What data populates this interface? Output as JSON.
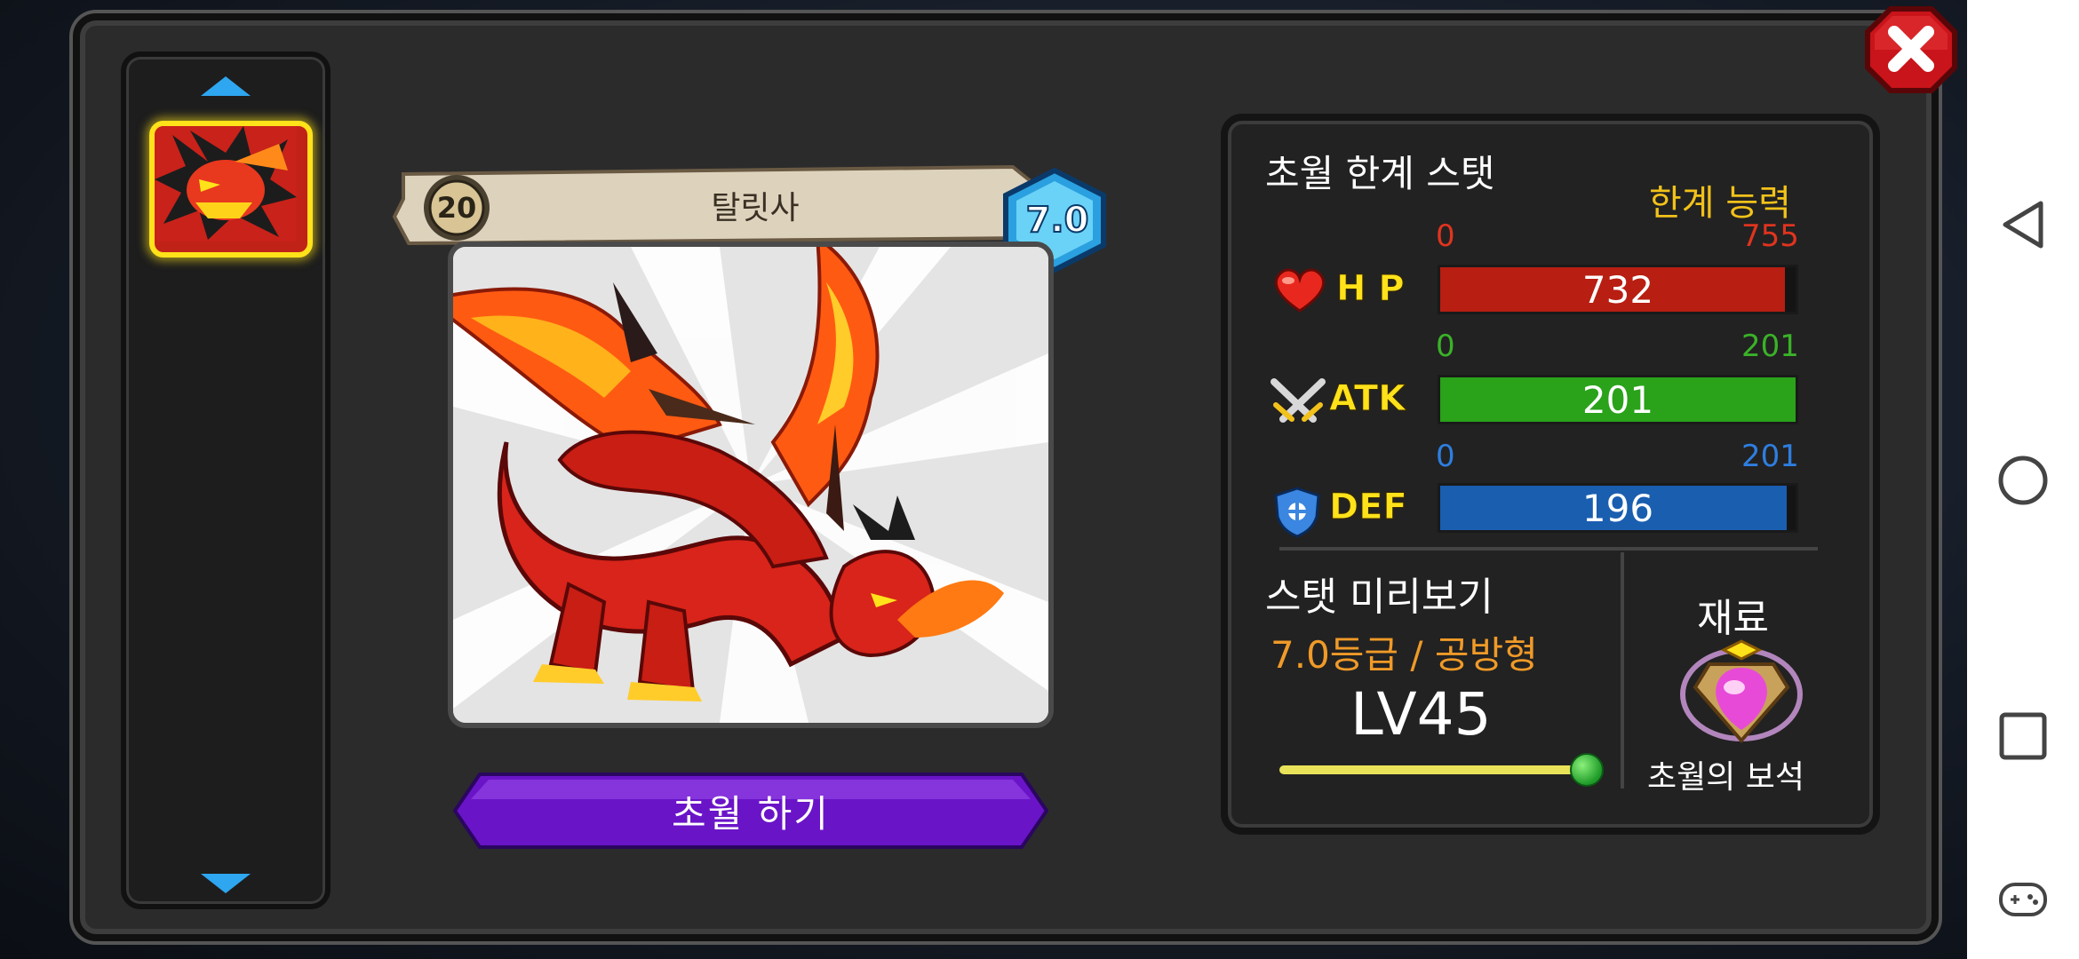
{
  "hero": {
    "level": "20",
    "name": "탈릿사",
    "grade": "7.0"
  },
  "actions": {
    "transcend_label": "초월 하기"
  },
  "stats": {
    "title": "초월 한계 스탯",
    "limit_label": "한계 능력",
    "rows": [
      {
        "label": "H P",
        "min": "0",
        "max": "755",
        "value": "732",
        "fill": 0.97,
        "color": "#b81e12",
        "range_min_color": "#e0341e",
        "range_max_color": "#e0341e"
      },
      {
        "label": "ATK",
        "min": "0",
        "max": "201",
        "value": "201",
        "fill": 1.0,
        "color": "#2aa21a",
        "range_min_color": "#3ab228",
        "range_max_color": "#3ab228"
      },
      {
        "label": "DEF",
        "min": "0",
        "max": "201",
        "value": "196",
        "fill": 0.975,
        "color": "#1a5eb0",
        "range_min_color": "#2e7ee0",
        "range_max_color": "#2e7ee0"
      }
    ]
  },
  "preview": {
    "title": "스탯 미리보기",
    "grade_type": "7.0등급 / 공방형",
    "level": "LV45",
    "slider_fraction": 1.0
  },
  "material": {
    "title": "재료",
    "name": "초월의 보석"
  },
  "colors": {
    "panel": "#2b2b2b",
    "button_purple": "#6a14c8",
    "highlight_yellow": "#ffe21a",
    "limit_gold": "#f2c21a",
    "grade_orange": "#f09a28"
  },
  "icons": [
    "close-icon",
    "arrow-up-icon",
    "arrow-down-icon",
    "heart-icon",
    "swords-icon",
    "shield-icon",
    "gem-icon",
    "back-icon",
    "home-icon",
    "recents-icon",
    "gamepad-icon"
  ]
}
